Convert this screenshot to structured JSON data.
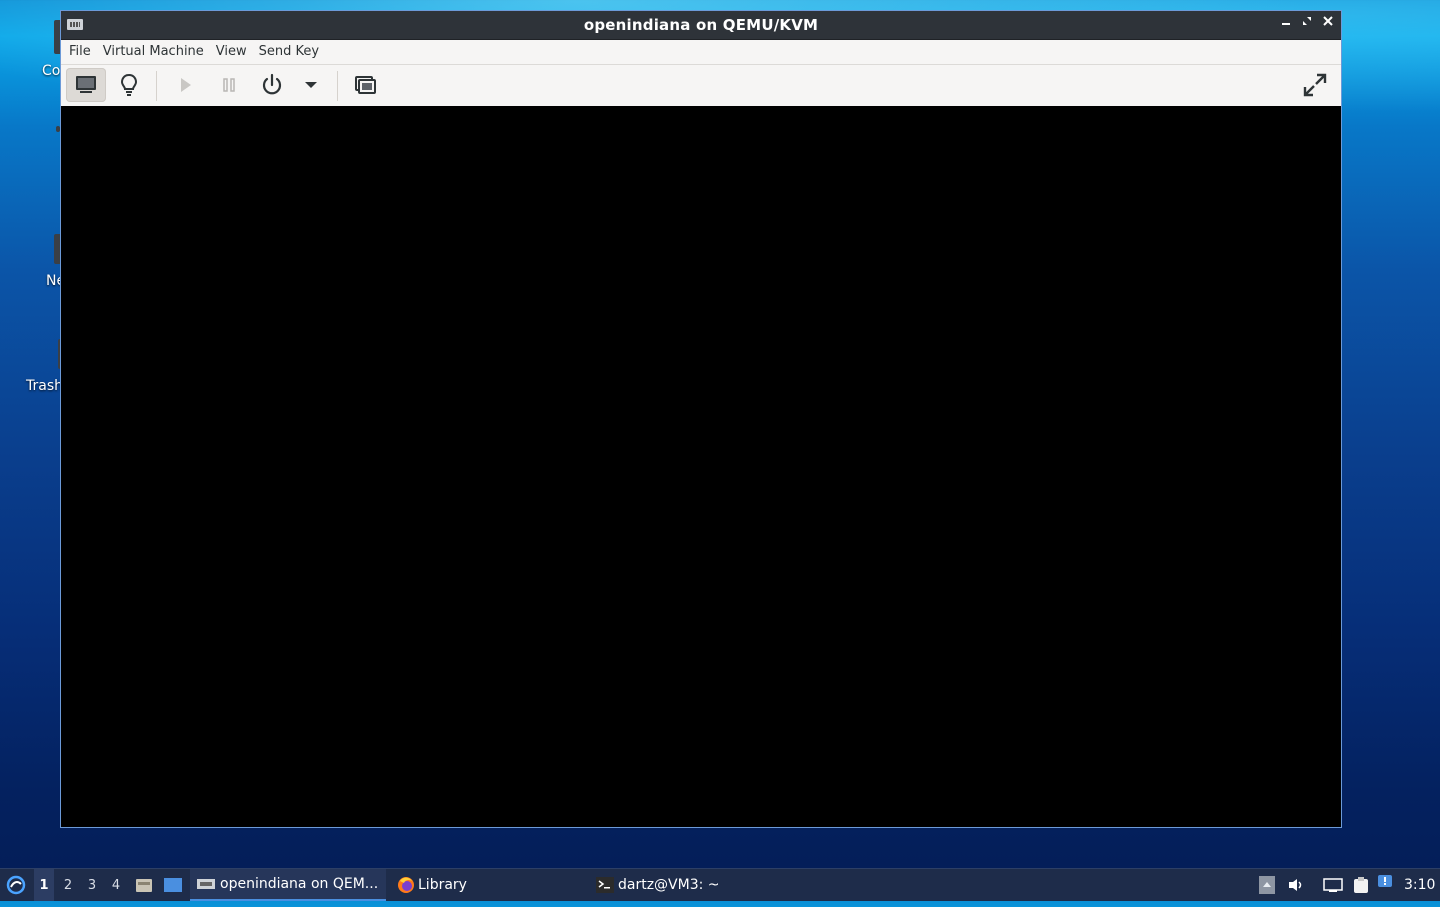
{
  "window": {
    "title": "openindiana on QEMU/KVM",
    "controls": {
      "minimize": "–",
      "maximize": "⤢",
      "close": "✕"
    }
  },
  "menubar": {
    "items": [
      "File",
      "Virtual Machine",
      "View",
      "Send Key"
    ]
  },
  "toolbar": {
    "buttons": [
      {
        "name": "console-view",
        "icon": "monitor-icon",
        "active": true
      },
      {
        "name": "details-view",
        "icon": "lightbulb-icon",
        "active": false
      },
      {
        "name": "run",
        "icon": "play-icon",
        "enabled": false
      },
      {
        "name": "pause",
        "icon": "pause-icon",
        "enabled": false
      },
      {
        "name": "shutdown",
        "icon": "power-icon",
        "enabled": true
      },
      {
        "name": "shutdown-menu",
        "icon": "caret-down-icon",
        "enabled": true
      },
      {
        "name": "snapshots",
        "icon": "snapshots-icon",
        "enabled": true
      },
      {
        "name": "fullscreen",
        "icon": "fullscreen-icon",
        "enabled": true
      }
    ]
  },
  "desktop": {
    "icons": [
      {
        "label": "Co"
      },
      {
        "label": "Ne"
      },
      {
        "label": "Trash"
      }
    ]
  },
  "taskbar": {
    "workspaces": [
      "1",
      "2",
      "3",
      "4"
    ],
    "active_workspace": "1",
    "tasks": [
      {
        "label": "openindiana on QEM...",
        "icon": "virt-manager-icon",
        "active": true
      },
      {
        "label": "Library",
        "icon": "firefox-icon",
        "active": false
      },
      {
        "label": "dartz@VM3: ~",
        "icon": "terminal-icon",
        "active": false
      }
    ],
    "clock": "3:10"
  },
  "colors": {
    "titlebar": "#2e3339",
    "toolbar": "#f6f5f4",
    "window_border": "#6c9ad8",
    "taskbar": "#1e2c4a",
    "console": "#000000"
  }
}
